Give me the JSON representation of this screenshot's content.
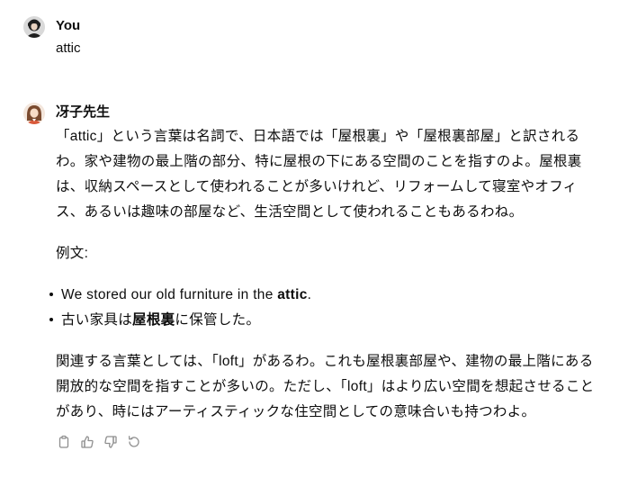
{
  "user_message": {
    "author": "You",
    "text": "attic"
  },
  "assistant_message": {
    "author": "冴子先生",
    "paragraph_1": "「attic」という言葉は名詞で、日本語では「屋根裏」や「屋根裏部屋」と訳されるわ。家や建物の最上階の部分、特に屋根の下にある空間のことを指すのよ。屋根裏は、収納スペースとして使われることが多いけれど、リフォームして寝室やオフィス、あるいは趣味の部屋など、生活空間として使われることもあるわね。",
    "example_label": "例文:",
    "examples": [
      {
        "before": "We stored our old furniture in the ",
        "bold": "attic",
        "after": "."
      },
      {
        "before": "古い家具は",
        "bold": "屋根裏",
        "after": "に保管した。"
      }
    ],
    "paragraph_2": "関連する言葉としては、「loft」があるわ。これも屋根裏部屋や、建物の最上階にある開放的な空間を指すことが多いの。ただし、「loft」はより広い空間を想起させることがあり、時にはアーティスティックな住空間としての意味合いも持つわよ。"
  },
  "actions": {
    "icons": [
      "copy-icon",
      "thumbs-up-icon",
      "thumbs-down-icon",
      "regenerate-icon"
    ]
  },
  "colors": {
    "text": "#0d0d0d",
    "icon": "#8e8e8e",
    "background": "#ffffff"
  }
}
